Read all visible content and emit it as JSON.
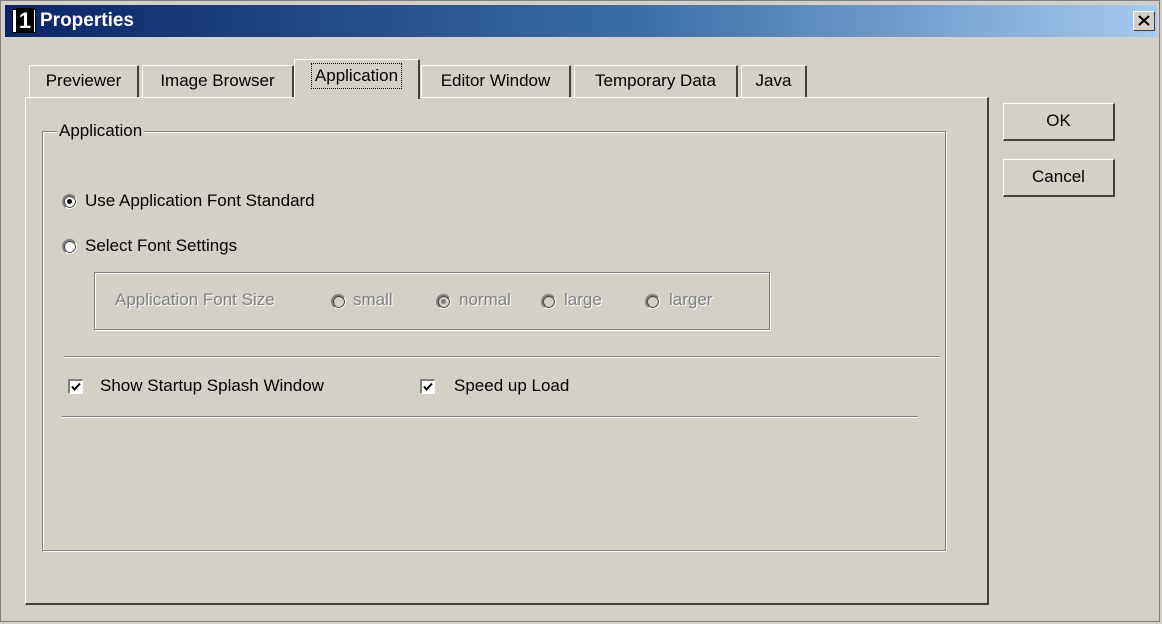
{
  "window": {
    "title": "Properties",
    "icon": "app-number-1-icon",
    "close_glyph": "✕"
  },
  "tabs": [
    {
      "label": "Previewer",
      "active": false
    },
    {
      "label": "Image Browser",
      "active": false
    },
    {
      "label": "Application",
      "active": true
    },
    {
      "label": "Editor Window",
      "active": false
    },
    {
      "label": "Temporary Data",
      "active": false
    },
    {
      "label": "Java",
      "active": false
    }
  ],
  "group": {
    "title": "Application",
    "radio_standard": {
      "label": "Use Application Font Standard",
      "checked": true
    },
    "radio_select": {
      "label": "Select Font Settings",
      "checked": false
    },
    "font_size": {
      "label": "Application Font Size",
      "options": [
        {
          "label": "small",
          "checked": false
        },
        {
          "label": "normal",
          "checked": true
        },
        {
          "label": "large",
          "checked": false
        },
        {
          "label": "larger",
          "checked": false
        }
      ],
      "enabled": false
    },
    "show_splash": {
      "label": "Show Startup Splash Window",
      "checked": true
    },
    "speed_up": {
      "label": "Speed up Load",
      "checked": true
    }
  },
  "buttons": {
    "ok": "OK",
    "cancel": "Cancel"
  },
  "colors": {
    "face": "#d4d0c8",
    "title_start": "#0a246a",
    "title_end": "#a6caf0"
  }
}
